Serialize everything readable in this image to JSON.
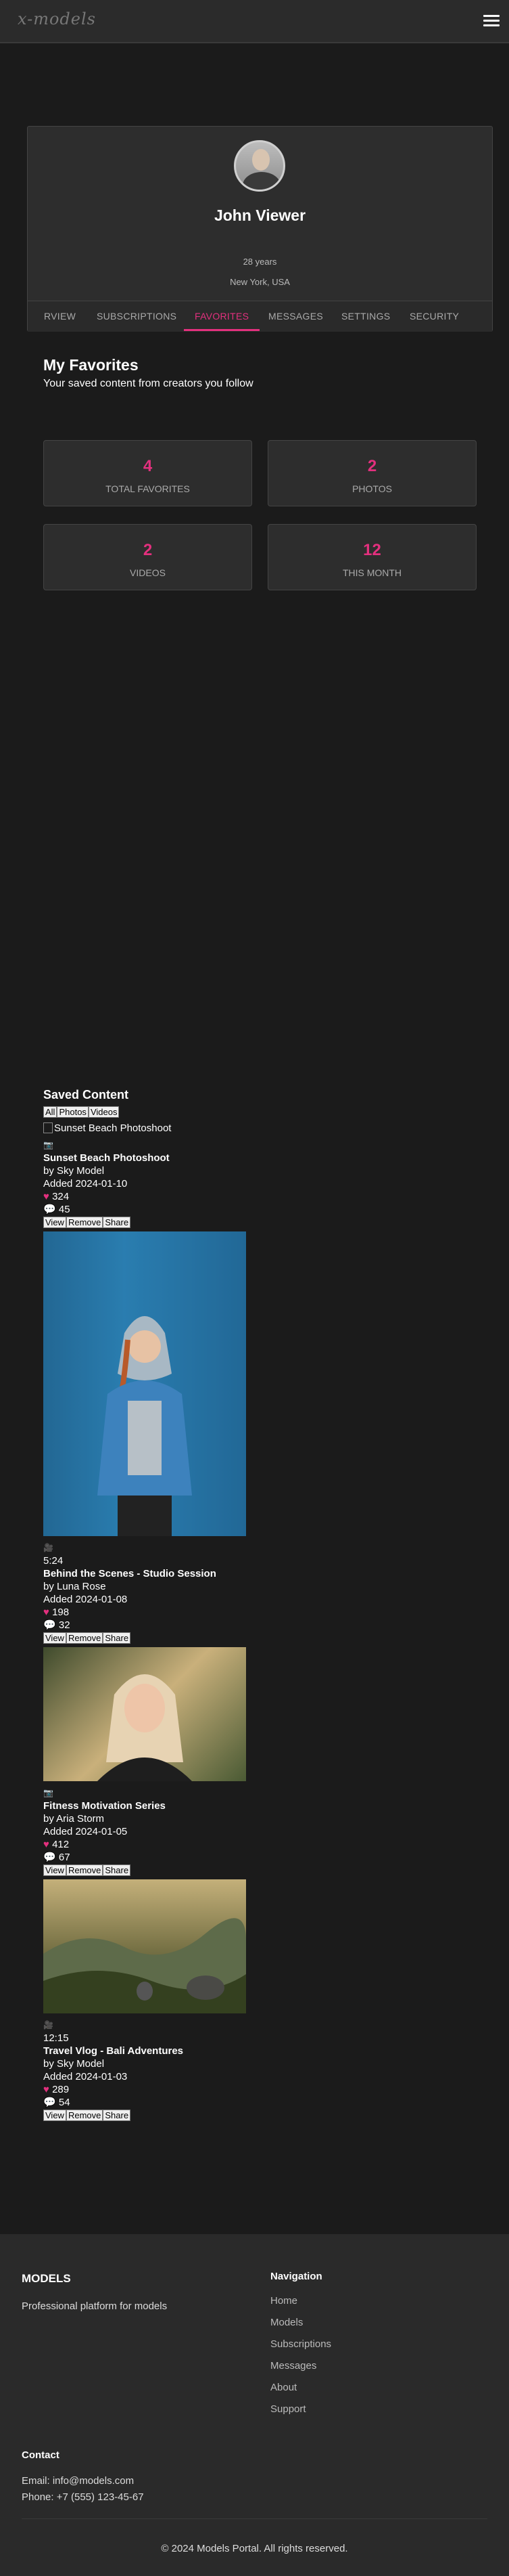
{
  "header": {
    "logo": "x-models",
    "menu_icon": "hamburger-icon"
  },
  "profile": {
    "name": "John Viewer",
    "age": "28 years",
    "location": "New York, USA"
  },
  "tabs": [
    "RVIEW",
    "SUBSCRIPTIONS",
    "FAVORITES",
    "MESSAGES",
    "SETTINGS",
    "SECURITY"
  ],
  "favorites": {
    "title": "My Favorites",
    "subtitle": "Your saved content from creators you follow",
    "stats": [
      {
        "value": "4",
        "label": "TOTAL FAVORITES"
      },
      {
        "value": "2",
        "label": "PHOTOS"
      },
      {
        "value": "2",
        "label": "VIDEOS"
      },
      {
        "value": "12",
        "label": "THIS MONTH"
      }
    ]
  },
  "saved": {
    "title": "Saved Content",
    "filters": [
      "All",
      "Photos",
      "Videos"
    ],
    "items": [
      {
        "alt": "Sunset Beach Photoshoot",
        "type_icon": "📷",
        "duration": "",
        "title": "Sunset Beach Photoshoot",
        "by": "by Sky Model",
        "added": "Added 2024-01-10",
        "likes": "324",
        "comments": "45"
      },
      {
        "alt": "",
        "type_icon": "🎥",
        "duration": "5:24",
        "title": "Behind the Scenes - Studio Session",
        "by": "by Luna Rose",
        "added": "Added 2024-01-08",
        "likes": "198",
        "comments": "32"
      },
      {
        "alt": "",
        "type_icon": "📷",
        "duration": "",
        "title": "Fitness Motivation Series",
        "by": "by Aria Storm",
        "added": "Added 2024-01-05",
        "likes": "412",
        "comments": "67"
      },
      {
        "alt": "",
        "type_icon": "🎥",
        "duration": "12:15",
        "title": "Travel Vlog - Bali Adventures",
        "by": "by Sky Model",
        "added": "Added 2024-01-03",
        "likes": "289",
        "comments": "54"
      }
    ],
    "actions": [
      "View",
      "Remove",
      "Share"
    ]
  },
  "footer": {
    "brand": "MODELS",
    "tagline": "Professional platform for models",
    "nav_title": "Navigation",
    "nav": [
      "Home",
      "Models",
      "Subscriptions",
      "Messages",
      "About",
      "Support"
    ],
    "contact_title": "Contact",
    "email": "Email: info@models.com",
    "phone": "Phone: +7 (555) 123-45-67",
    "copyright": "© 2024 Models Portal. All rights reserved."
  },
  "colors": {
    "accent": "#e3307e",
    "bg": "#1b1b1b",
    "panel": "#2d2d2d"
  }
}
